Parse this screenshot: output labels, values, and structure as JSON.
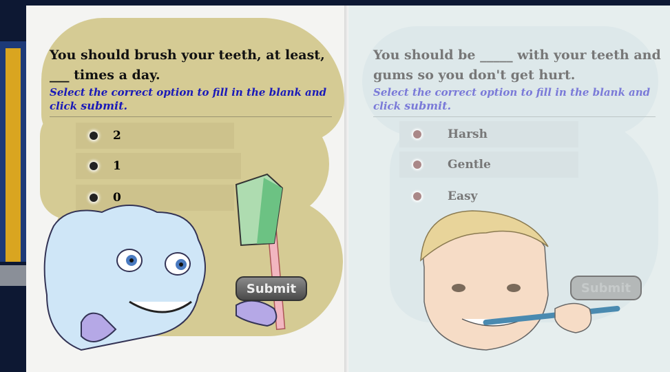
{
  "left_page": {
    "question": "You should brush your teeth, at least, ___ times a day.",
    "instruction_prefix": "Select the correct option to fill in the blank and click",
    "instruction_bold": "submit.",
    "options": [
      "2",
      "1",
      "0"
    ],
    "submit_label": "Submit"
  },
  "right_page": {
    "question": "You should be _____ with your teeth and gums so you don't get hurt.",
    "instruction_prefix": "Select the correct option to fill in the blank and click",
    "instruction_bold": "submit.",
    "options": [
      "Harsh",
      "Gentle",
      "Easy"
    ],
    "submit_label": "Submit"
  },
  "colors": {
    "background": "#0d1833",
    "left_blob": "#d5cb94",
    "right_blob": "#dde8ea",
    "instruction": "#1a1ab8",
    "instruction_faded": "#7a7ad8"
  }
}
